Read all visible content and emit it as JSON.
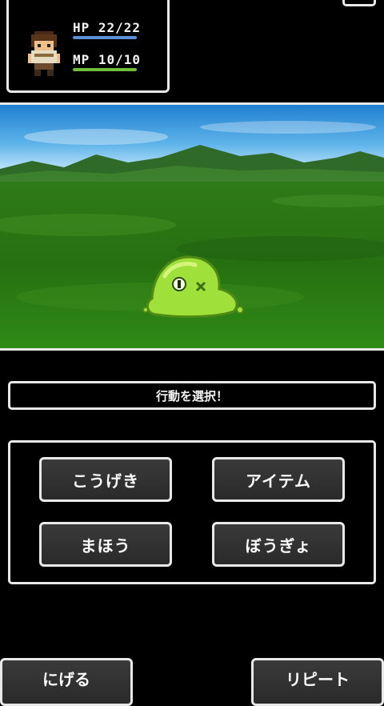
{
  "status": {
    "hp_text": "HP  22/22",
    "mp_text": "MP  10/10",
    "hp_fraction": 1.0,
    "mp_fraction": 1.0,
    "hp_color": "#5b8fd6",
    "mp_color": "#6fbf3a"
  },
  "battle": {
    "enemy": "green-slime",
    "scene": "grassland"
  },
  "message": "行動を選択！",
  "commands": {
    "attack": "こうげき",
    "item": "アイテム",
    "magic": "まほう",
    "defend": "ぼうぎょ"
  },
  "bottom": {
    "flee": "にげる",
    "repeat": "リピート"
  },
  "colors": {
    "frame": "#e8e8e8",
    "button_bg": "#333333",
    "slime": "#9fe03a"
  }
}
